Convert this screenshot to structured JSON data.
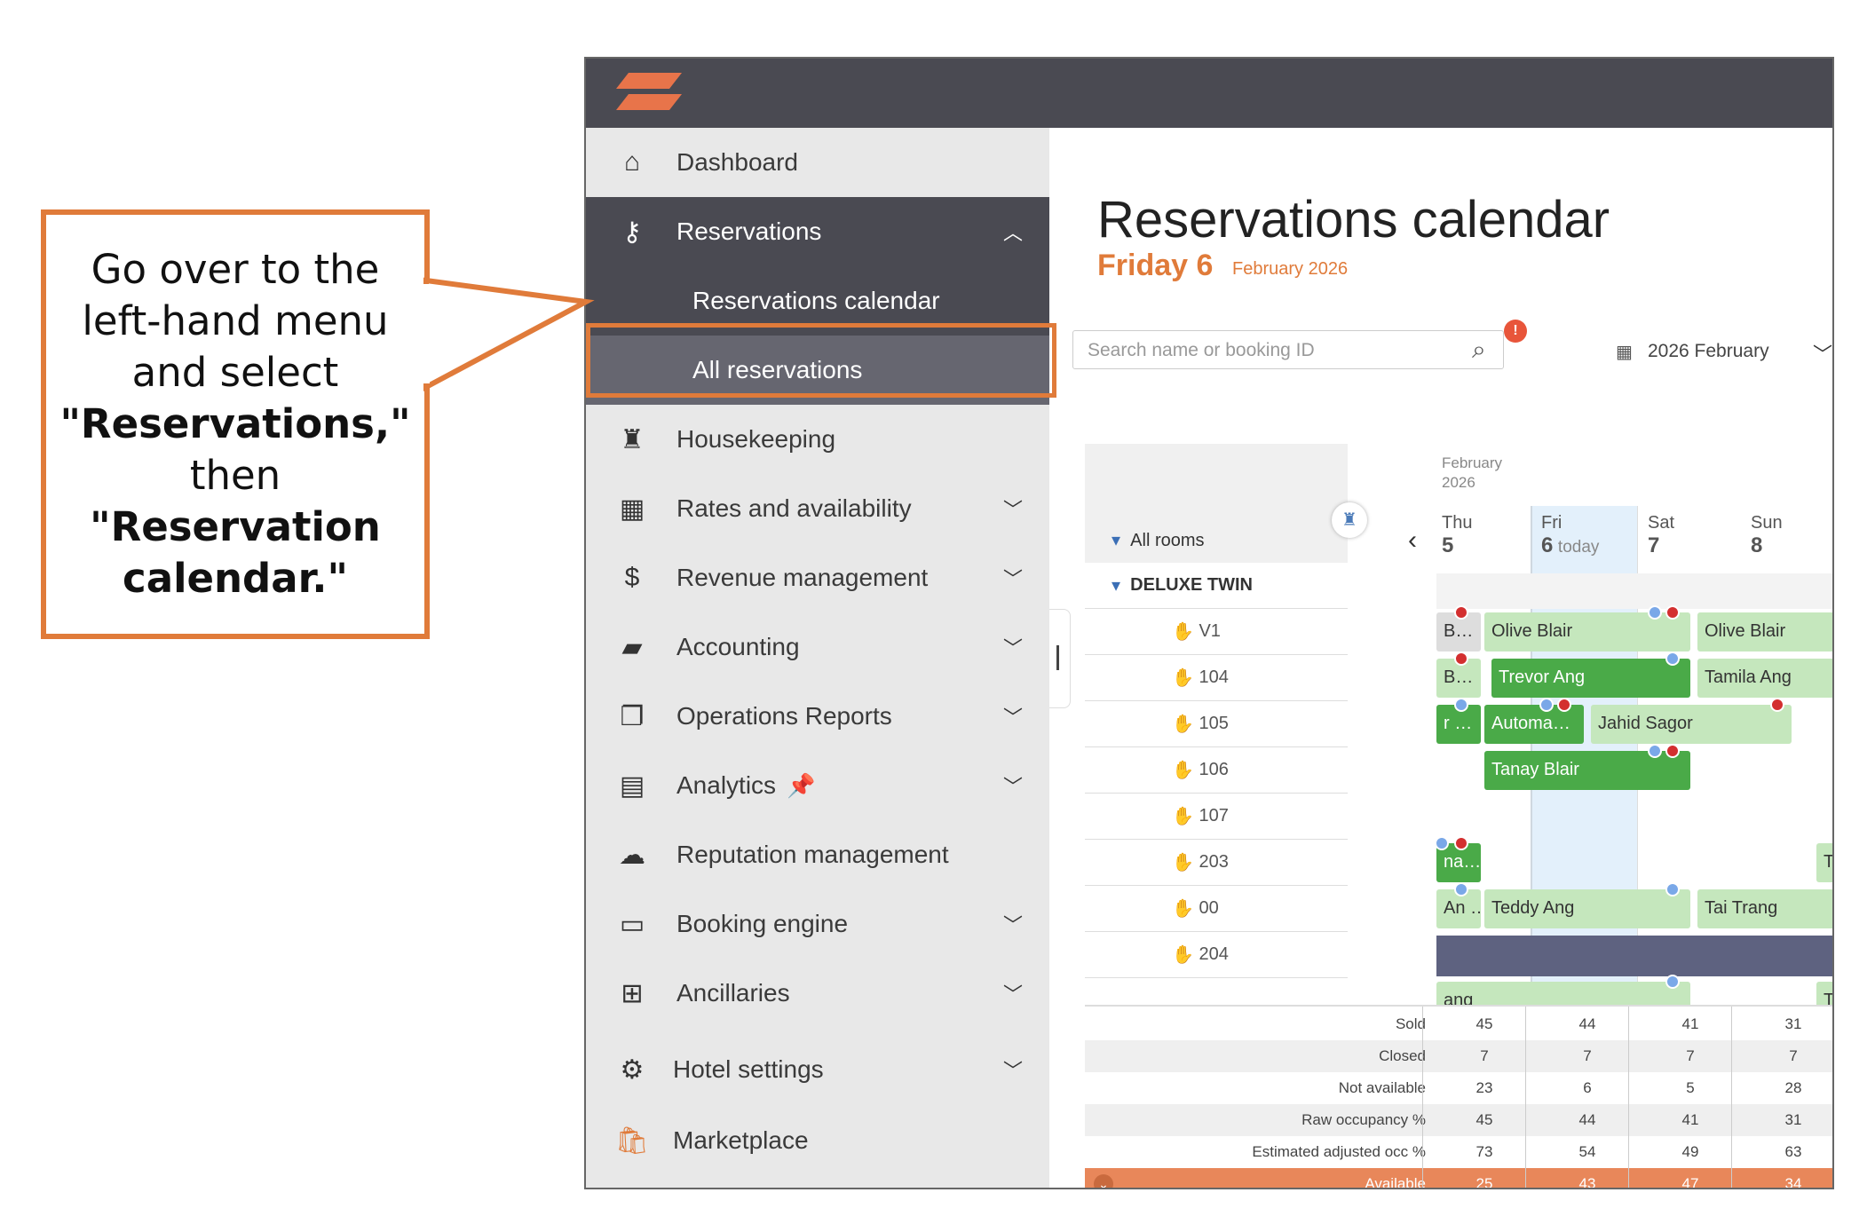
{
  "callout": {
    "line1": "Go over to the",
    "line2": "left-hand menu",
    "line3": "and select",
    "line4": "\"Reservations,\"",
    "line5": "then",
    "line6": "\"Reservation",
    "line7": "calendar.\""
  },
  "sidebar": {
    "items": [
      {
        "label": "Dashboard",
        "icon": "home-icon"
      },
      {
        "label": "Reservations",
        "icon": "key-icon"
      },
      {
        "label": "Reservations calendar"
      },
      {
        "label": "All reservations"
      },
      {
        "label": "Housekeeping",
        "icon": "housekeeping-icon"
      },
      {
        "label": "Rates and availability",
        "icon": "calendar-icon"
      },
      {
        "label": "Revenue management",
        "icon": "dollar-icon"
      },
      {
        "label": "Accounting",
        "icon": "wallet-icon"
      },
      {
        "label": "Operations Reports",
        "icon": "reports-icon"
      },
      {
        "label": "Analytics",
        "icon": "analytics-icon"
      },
      {
        "label": "Reputation management",
        "icon": "chat-icon"
      },
      {
        "label": "Booking engine",
        "icon": "browser-icon"
      },
      {
        "label": "Ancillaries",
        "icon": "plus-icon"
      },
      {
        "label": "Hotel settings",
        "icon": "gear-icon"
      },
      {
        "label": "Marketplace",
        "icon": "bag-icon"
      }
    ]
  },
  "main": {
    "title": "Reservations calendar",
    "day": "Friday 6",
    "date_sub": "February 2026",
    "search_placeholder": "Search name or booking ID",
    "badge": "!",
    "month_picker": "2026 February"
  },
  "calendar": {
    "month_label_1": "February",
    "month_label_2": "2026",
    "all_rooms": "All rooms",
    "room_type": "DELUXE TWIN",
    "rooms": [
      "V1",
      "104",
      "105",
      "106",
      "107",
      "203",
      "00",
      "204"
    ],
    "days": [
      {
        "dow": "Thu",
        "num": "5",
        "extra": ""
      },
      {
        "dow": "Fri",
        "num": "6",
        "extra": "today"
      },
      {
        "dow": "Sat",
        "num": "7",
        "extra": ""
      },
      {
        "dow": "Sun",
        "num": "8",
        "extra": ""
      }
    ],
    "bookings": {
      "b1": "B…",
      "b2": "Olive Blair",
      "b3": "Olive Blair",
      "b4": "B…",
      "b5": "Trevor Ang",
      "b6": "Tamila Ang",
      "b7": "r …",
      "b8": "Automa…",
      "b9": "Jahid Sagor",
      "b10": "Tanay Blair",
      "b11": "na…",
      "b12": "Ta",
      "b13": "An …",
      "b14": "Teddy Ang",
      "b15": "Tai Trang",
      "b16": "ang",
      "b17": "T"
    }
  },
  "stats": {
    "rows": [
      {
        "label": "Sold",
        "values": [
          "45",
          "44",
          "41",
          "31"
        ]
      },
      {
        "label": "Closed",
        "values": [
          "7",
          "7",
          "7",
          "7"
        ]
      },
      {
        "label": "Not available",
        "values": [
          "23",
          "6",
          "5",
          "28"
        ]
      },
      {
        "label": "Raw occupancy %",
        "values": [
          "45",
          "44",
          "41",
          "31"
        ]
      },
      {
        "label": "Estimated adjusted occ %",
        "values": [
          "73",
          "54",
          "49",
          "63"
        ]
      },
      {
        "label": "Available",
        "values": [
          "25",
          "43",
          "47",
          "34"
        ]
      }
    ]
  },
  "colors": {
    "accent": "#e07b3a",
    "dark": "#4a4a52",
    "green": "#4aaa48",
    "light_green": "#c5e7bd"
  }
}
